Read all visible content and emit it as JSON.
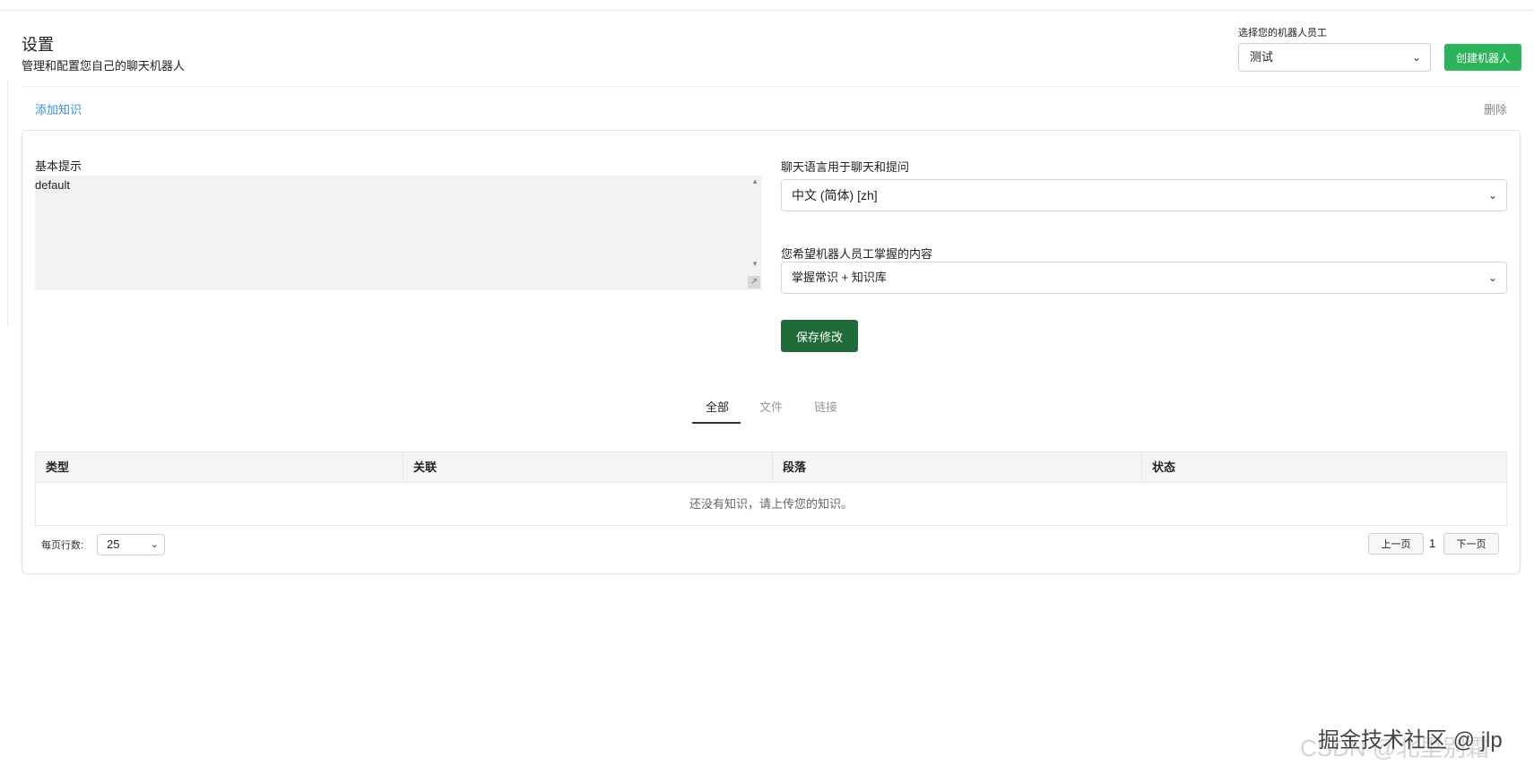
{
  "header": {
    "title": "设置",
    "subtitle": "管理和配置您自己的聊天机器人",
    "bot_select_label": "选择您的机器人员工",
    "bot_select_value": "测试",
    "create_bot_label": "创建机器人",
    "create_bot_color": "#2bb45a"
  },
  "toolbar": {
    "add_knowledge_label": "添加知识",
    "delete_label": "删除"
  },
  "form": {
    "prompt_label": "基本提示",
    "prompt_value": "default",
    "language_label": "聊天语言用于聊天和提问",
    "language_value": "中文 (简体) [zh]",
    "mastery_label": "您希望机器人员工掌握的内容",
    "mastery_value": "掌握常识 + 知识库",
    "save_label": "保存修改",
    "save_color": "#1f6b3a"
  },
  "tabs": [
    {
      "label": "全部",
      "active": true
    },
    {
      "label": "文件",
      "active": false
    },
    {
      "label": "链接",
      "active": false
    }
  ],
  "table": {
    "headers": [
      "类型",
      "关联",
      "段落",
      "状态"
    ],
    "empty_text": "还没有知识，请上传您的知识。"
  },
  "pagination": {
    "rows_label": "每页行数:",
    "rows_value": "25",
    "prev_label": "上一页",
    "page": "1",
    "next_label": "下一页"
  },
  "watermark": {
    "front": "掘金技术社区 @ jlp",
    "back": "CSDN @北里别霜"
  },
  "icons": {
    "dropdown": "chevron-down-icon",
    "resize": "resize-grip-icon"
  }
}
